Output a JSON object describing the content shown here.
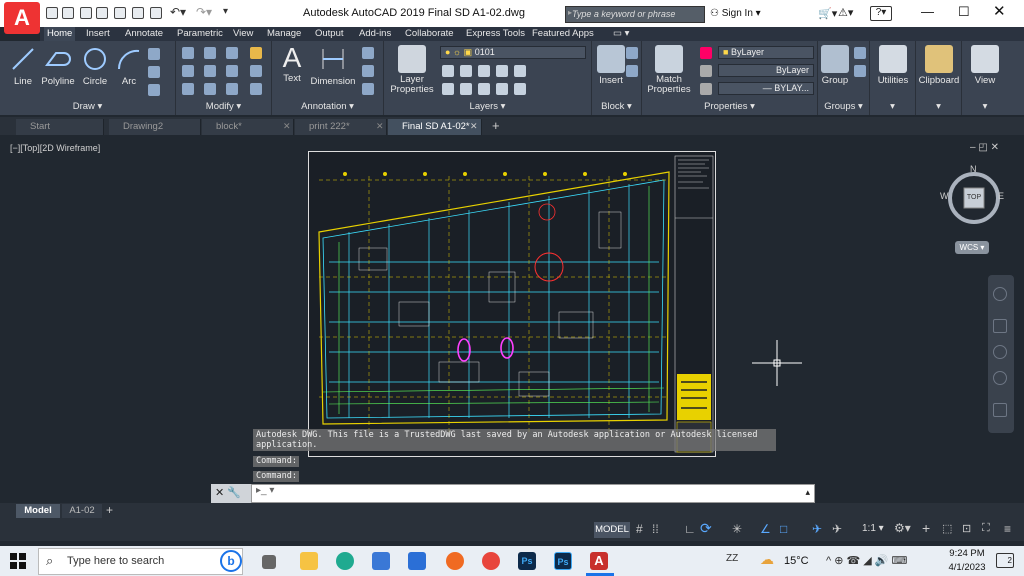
{
  "window": {
    "title": "Autodesk AutoCAD 2019    Final SD A1-02.dwg",
    "app_letter": "A"
  },
  "search": {
    "placeholder": "Type a keyword or phrase"
  },
  "account": {
    "sign_in": "Sign In"
  },
  "ribbon_tabs": [
    "Home",
    "Insert",
    "Annotate",
    "Parametric",
    "View",
    "Manage",
    "Output",
    "Add-ins",
    "Collaborate",
    "Express Tools",
    "Featured Apps"
  ],
  "draw": {
    "tools": [
      "Line",
      "Polyline",
      "Circle",
      "Arc"
    ],
    "title": "Draw ▾"
  },
  "modify": {
    "title": "Modify ▾"
  },
  "annotation": {
    "tools": [
      "Text",
      "Dimension"
    ],
    "title": "Annotation ▾"
  },
  "layers": {
    "tool": "Layer Properties",
    "current_layer": "0101",
    "title": "Layers ▾"
  },
  "block": {
    "tool": "Insert",
    "title": "Block ▾"
  },
  "properties": {
    "tool": "Match Properties",
    "color": "ByLayer",
    "linetype": "ByLayer",
    "lineweight": "— BYLAY...",
    "title": "Properties ▾"
  },
  "groups": {
    "tool": "Group",
    "title": "Groups ▾"
  },
  "extra_tools": [
    "Utilities",
    "Clipboard",
    "View"
  ],
  "doc_tabs": [
    "Start",
    "Drawing2",
    "block*",
    "print 222*",
    "Final SD A1-02*"
  ],
  "viewport": {
    "label": "[−][Top][2D Wireframe]"
  },
  "viewcube": {
    "top": "TOP",
    "n": "N",
    "s": "S",
    "e": "E",
    "w": "W",
    "wcs": "WCS ▾"
  },
  "command": {
    "history": "Autodesk DWG.  This file is a TrustedDWG last saved by an Autodesk application or Autodesk licensed application.",
    "line1": "Command:",
    "line2": "Command:"
  },
  "model_tabs": [
    "Model",
    "A1-02"
  ],
  "status": {
    "model": "MODEL",
    "scale": "1:1 ▾"
  },
  "taskbar": {
    "search": "Type here to search",
    "temp": "15°C",
    "time": "9:24 PM",
    "date": "4/1/2023",
    "notif_count": "2",
    "keyboard": "ZZ"
  }
}
